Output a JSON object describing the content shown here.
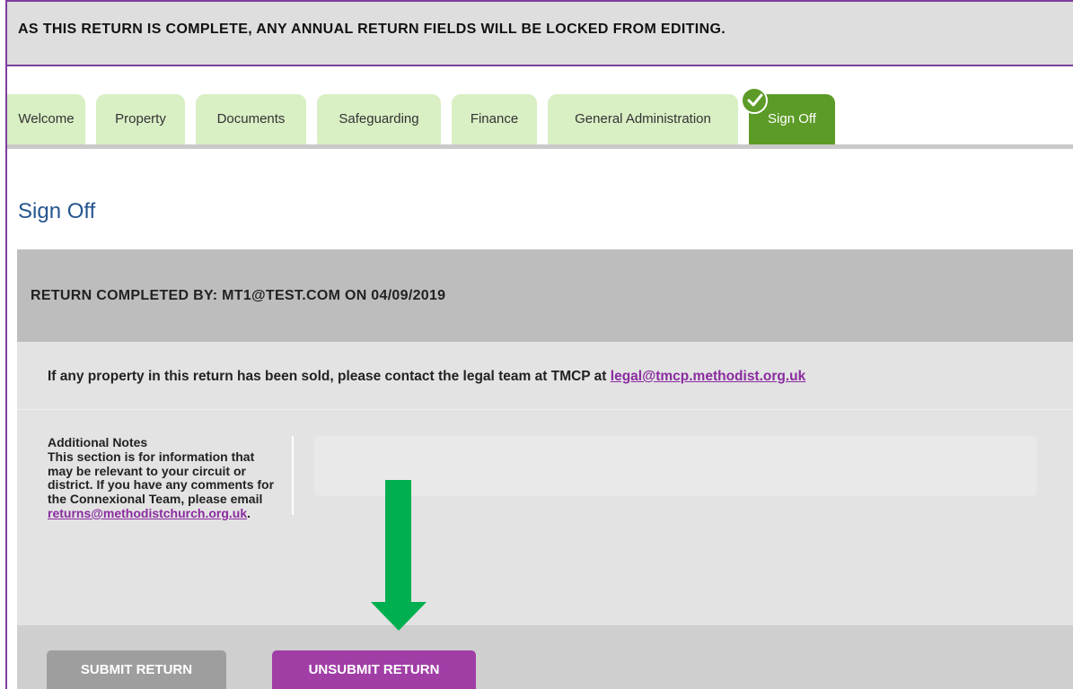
{
  "banner": {
    "message": "AS THIS RETURN IS COMPLETE, ANY ANNUAL RETURN FIELDS WILL BE LOCKED FROM EDITING."
  },
  "tabs": [
    {
      "label": "Welcome"
    },
    {
      "label": "Property"
    },
    {
      "label": "Documents"
    },
    {
      "label": "Safeguarding"
    },
    {
      "label": "Finance"
    },
    {
      "label": "General Administration"
    },
    {
      "label": "Sign Off",
      "active": true,
      "icon": "check-icon"
    }
  ],
  "page": {
    "title": "Sign Off"
  },
  "panel": {
    "heading": "RETURN COMPLETED BY: MT1@TEST.COM ON 04/09/2019",
    "info_prefix": "If any property in this return has been sold, please contact the legal team at TMCP at ",
    "info_link": "legal@tmcp.methodist.org.uk",
    "notes": {
      "title": "Additional Notes",
      "description": "This section is for information that may be relevant to your circuit or district. If you have any comments for the Connexional Team, please email",
      "email": "returns@methodistchurch.org.uk",
      "suffix": ".",
      "value": ""
    }
  },
  "buttons": {
    "submit": "SUBMIT RETURN",
    "unsubmit": "UNSUBMIT RETURN"
  },
  "annotation": {
    "arrow_icon": "arrow-down-icon",
    "arrow_color": "#00b050"
  },
  "colors": {
    "accent": "#7b3f9e",
    "tab_inactive": "#d9efc4",
    "tab_active": "#5c9b27",
    "title": "#25558f",
    "link": "#8a2ba0",
    "unsubmit": "#a03ea6"
  }
}
